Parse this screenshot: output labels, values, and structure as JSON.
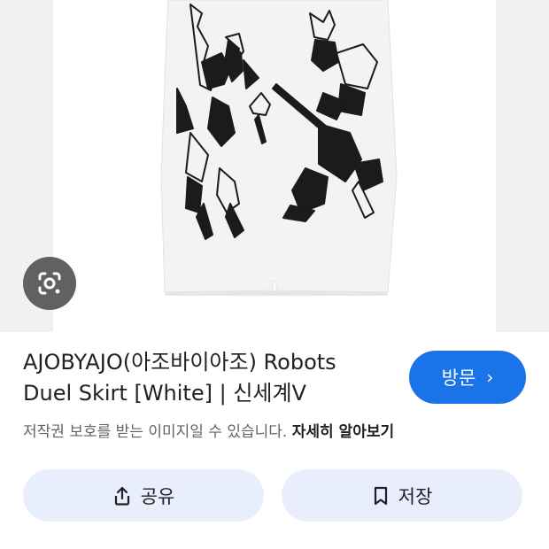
{
  "product": {
    "title_line1": "AJOBYAJO(아조바이아조) Robots",
    "title_line2": "Duel Skirt [White] | 신세계V",
    "image_alt": "AJOBYAJO Robots Duel Skirt White"
  },
  "visit_button": {
    "label": "방문",
    "chevron": "›"
  },
  "copyright": {
    "notice": "저작권 보호를 받는 이미지일 수 있습니다.",
    "learn_more": "자세히 알아보기"
  },
  "actions": {
    "share_label": "공유",
    "save_label": "저장"
  },
  "icons": {
    "lens": "google-lens-icon",
    "share": "share-icon",
    "save": "bookmark-icon"
  },
  "colors": {
    "accent": "#1a73e8",
    "chip_bg": "#e8eefb",
    "lens_bg": "#5f6163"
  }
}
